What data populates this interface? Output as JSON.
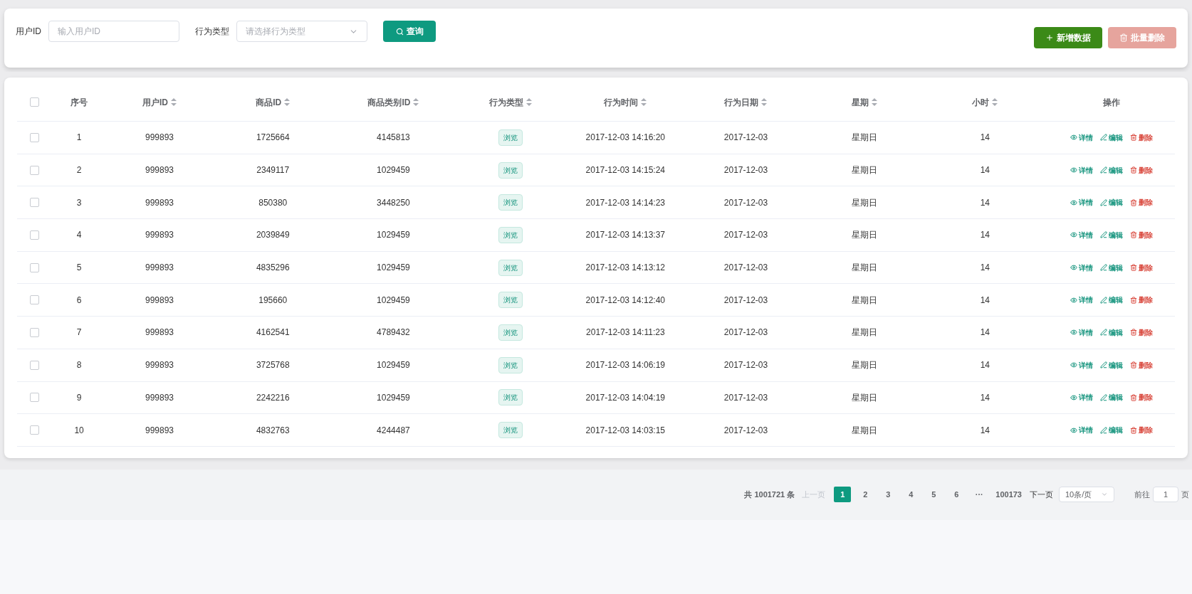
{
  "filters": [
    {
      "label": "用户ID",
      "kind": "input",
      "placeholder": "输入用户ID"
    },
    {
      "label": "行为类型",
      "kind": "select",
      "placeholder": "请选择行为类型"
    }
  ],
  "search_button": "查询",
  "actions": [
    {
      "label": "新增数据",
      "kind": "add",
      "disabled": false
    },
    {
      "label": "批量删除",
      "kind": "delete",
      "disabled": true
    }
  ],
  "table": {
    "select_all_checked": false,
    "columns": [
      {
        "label": "序号",
        "sortable": false
      },
      {
        "label": "用户ID",
        "sortable": true
      },
      {
        "label": "商品ID",
        "sortable": true
      },
      {
        "label": "商品类别ID",
        "sortable": true
      },
      {
        "label": "行为类型",
        "sortable": true
      },
      {
        "label": "行为时间",
        "sortable": true
      },
      {
        "label": "行为日期",
        "sortable": true
      },
      {
        "label": "星期",
        "sortable": true
      },
      {
        "label": "小时",
        "sortable": true
      },
      {
        "label": "操作",
        "sortable": false
      }
    ],
    "rows": [
      {
        "checked": false,
        "cells": [
          "1",
          "999893",
          "1725664",
          "4145813",
          "浏览",
          "2017-12-03 14:16:20",
          "2017-12-03",
          "星期日",
          "14"
        ],
        "actions": [
          {
            "label": "详情",
            "kind": "view"
          },
          {
            "label": "编辑",
            "kind": "edit"
          },
          {
            "label": "删除",
            "kind": "delete"
          }
        ]
      },
      {
        "checked": false,
        "cells": [
          "2",
          "999893",
          "2349117",
          "1029459",
          "浏览",
          "2017-12-03 14:15:24",
          "2017-12-03",
          "星期日",
          "14"
        ],
        "actions": [
          {
            "label": "详情",
            "kind": "view"
          },
          {
            "label": "编辑",
            "kind": "edit"
          },
          {
            "label": "删除",
            "kind": "delete"
          }
        ]
      },
      {
        "checked": false,
        "cells": [
          "3",
          "999893",
          "850380",
          "3448250",
          "浏览",
          "2017-12-03 14:14:23",
          "2017-12-03",
          "星期日",
          "14"
        ],
        "actions": [
          {
            "label": "详情",
            "kind": "view"
          },
          {
            "label": "编辑",
            "kind": "edit"
          },
          {
            "label": "删除",
            "kind": "delete"
          }
        ]
      },
      {
        "checked": false,
        "cells": [
          "4",
          "999893",
          "2039849",
          "1029459",
          "浏览",
          "2017-12-03 14:13:37",
          "2017-12-03",
          "星期日",
          "14"
        ],
        "actions": [
          {
            "label": "详情",
            "kind": "view"
          },
          {
            "label": "编辑",
            "kind": "edit"
          },
          {
            "label": "删除",
            "kind": "delete"
          }
        ]
      },
      {
        "checked": false,
        "cells": [
          "5",
          "999893",
          "4835296",
          "1029459",
          "浏览",
          "2017-12-03 14:13:12",
          "2017-12-03",
          "星期日",
          "14"
        ],
        "actions": [
          {
            "label": "详情",
            "kind": "view"
          },
          {
            "label": "编辑",
            "kind": "edit"
          },
          {
            "label": "删除",
            "kind": "delete"
          }
        ]
      },
      {
        "checked": false,
        "cells": [
          "6",
          "999893",
          "195660",
          "1029459",
          "浏览",
          "2017-12-03 14:12:40",
          "2017-12-03",
          "星期日",
          "14"
        ],
        "actions": [
          {
            "label": "详情",
            "kind": "view"
          },
          {
            "label": "编辑",
            "kind": "edit"
          },
          {
            "label": "删除",
            "kind": "delete"
          }
        ]
      },
      {
        "checked": false,
        "cells": [
          "7",
          "999893",
          "4162541",
          "4789432",
          "浏览",
          "2017-12-03 14:11:23",
          "2017-12-03",
          "星期日",
          "14"
        ],
        "actions": [
          {
            "label": "详情",
            "kind": "view"
          },
          {
            "label": "编辑",
            "kind": "edit"
          },
          {
            "label": "删除",
            "kind": "delete"
          }
        ]
      },
      {
        "checked": false,
        "cells": [
          "8",
          "999893",
          "3725768",
          "1029459",
          "浏览",
          "2017-12-03 14:06:19",
          "2017-12-03",
          "星期日",
          "14"
        ],
        "actions": [
          {
            "label": "详情",
            "kind": "view"
          },
          {
            "label": "编辑",
            "kind": "edit"
          },
          {
            "label": "删除",
            "kind": "delete"
          }
        ]
      },
      {
        "checked": false,
        "cells": [
          "9",
          "999893",
          "2242216",
          "1029459",
          "浏览",
          "2017-12-03 14:04:19",
          "2017-12-03",
          "星期日",
          "14"
        ],
        "actions": [
          {
            "label": "详情",
            "kind": "view"
          },
          {
            "label": "编辑",
            "kind": "edit"
          },
          {
            "label": "删除",
            "kind": "delete"
          }
        ]
      },
      {
        "checked": false,
        "cells": [
          "10",
          "999893",
          "4832763",
          "4244487",
          "浏览",
          "2017-12-03 14:03:15",
          "2017-12-03",
          "星期日",
          "14"
        ],
        "actions": [
          {
            "label": "详情",
            "kind": "view"
          },
          {
            "label": "编辑",
            "kind": "edit"
          },
          {
            "label": "删除",
            "kind": "delete"
          }
        ]
      }
    ]
  },
  "pagination": {
    "total": "共 1001721 条",
    "prev": {
      "label": "上一页",
      "disabled": true
    },
    "pages": [
      {
        "label": "1",
        "selected": true
      },
      {
        "label": "2",
        "selected": false
      },
      {
        "label": "3",
        "selected": false
      },
      {
        "label": "4",
        "selected": false
      },
      {
        "label": "5",
        "selected": false
      },
      {
        "label": "6",
        "selected": false
      },
      {
        "label": "···",
        "selected": false
      },
      {
        "label": "100173",
        "selected": false
      }
    ],
    "next": {
      "label": "下一页",
      "disabled": false
    },
    "page_size": "10条/页",
    "goto_label": "前往",
    "goto_value": "1",
    "goto_suffix": "页"
  }
}
